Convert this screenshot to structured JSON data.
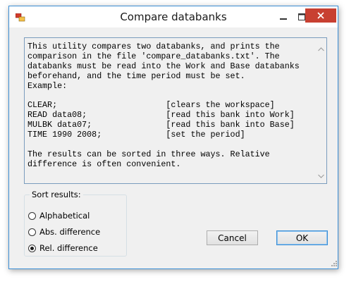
{
  "window": {
    "title": "Compare databanks"
  },
  "info": {
    "lines": [
      "This utility compares two databanks, and prints the",
      "comparison in the file 'compare_databanks.txt'. The",
      "databanks must be read into the Work and Base databanks",
      "beforehand, and the time period must be set.",
      "Example:",
      "",
      "CLEAR;                      [clears the workspace]",
      "READ data08;                [read this bank into Work]",
      "MULBK data07;               [read this bank into Base]",
      "TIME 1990 2008;             [set the period]",
      "",
      "The results can be sorted in three ways. Relative",
      "difference is often convenient."
    ]
  },
  "sort": {
    "label": "Sort results:",
    "options": [
      {
        "label": "Alphabetical",
        "checked": false
      },
      {
        "label": "Abs. difference",
        "checked": false
      },
      {
        "label": "Rel. difference",
        "checked": true
      }
    ]
  },
  "buttons": {
    "cancel": "Cancel",
    "ok": "OK"
  },
  "colors": {
    "close_button": "#c84031",
    "window_border": "#3c8fd6"
  }
}
